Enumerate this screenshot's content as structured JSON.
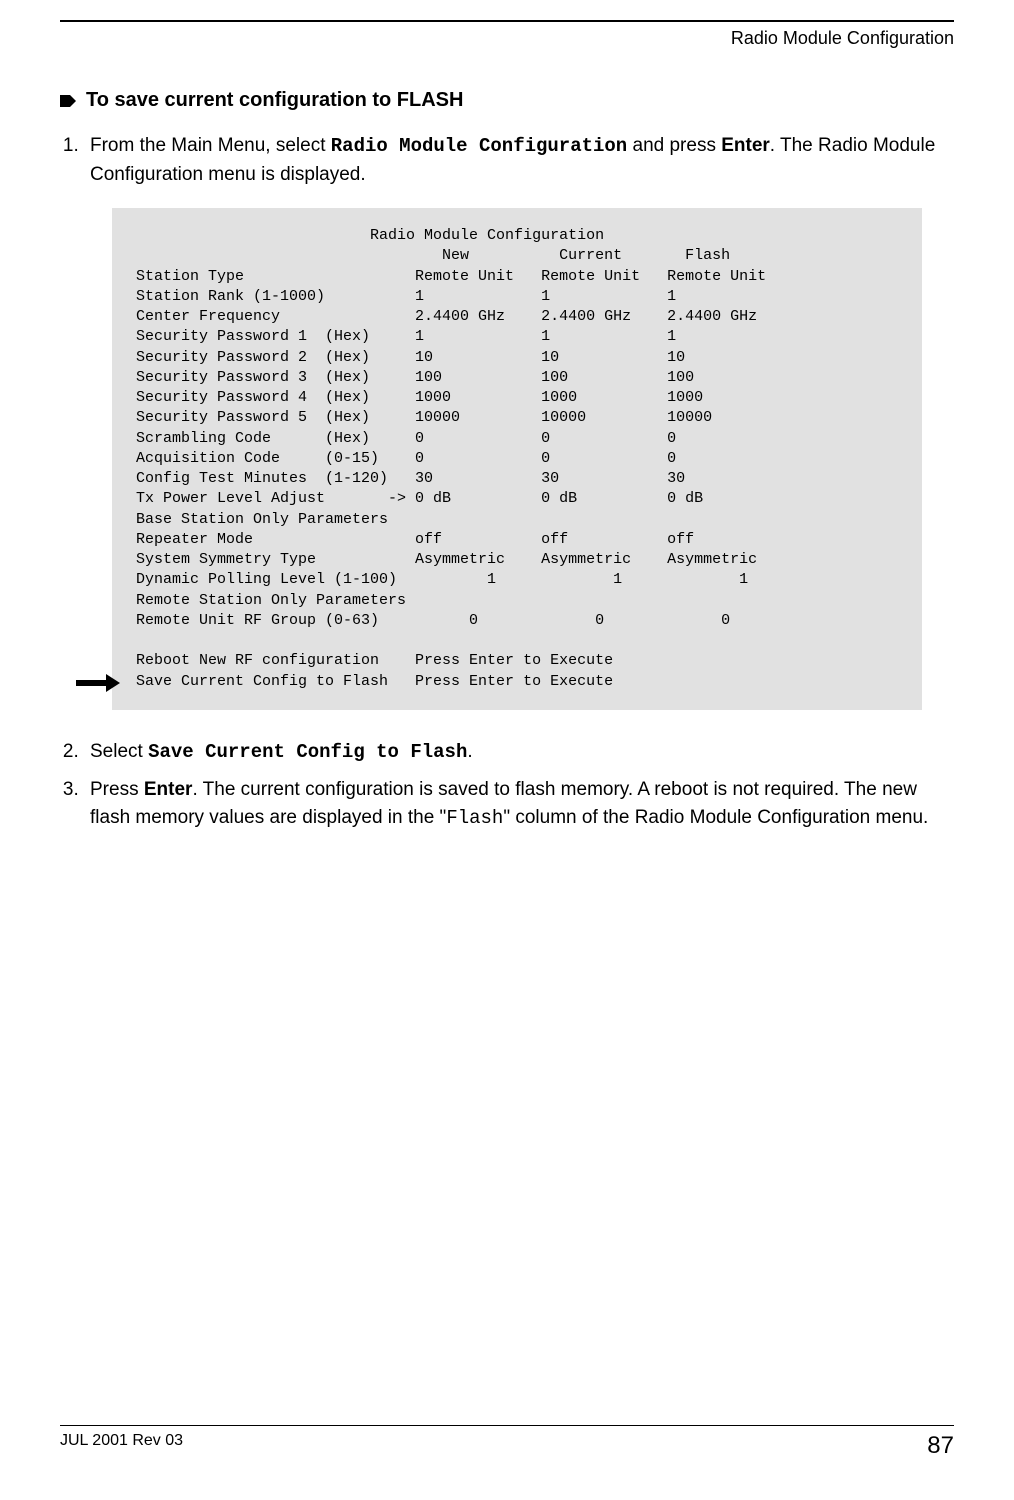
{
  "header": {
    "section": "Radio Module Configuration"
  },
  "section_title": "To save current configuration to FLASH",
  "steps": {
    "s1": {
      "pre": "From the Main Menu, select ",
      "menu": "Radio Module Configuration",
      "mid": " and press ",
      "key": "Enter",
      "post": ". The Radio Module Configuration menu is displayed."
    },
    "s2": {
      "pre": "Select ",
      "menu": "Save Current Config to Flash",
      "post": "."
    },
    "s3": {
      "pre": "Press ",
      "key": "Enter",
      "mid": ". The current configuration is saved to flash memory. A reboot is not required. The new flash memory values are displayed in the \"",
      "col": "Flash",
      "post": "\" column of the Radio Module Configuration menu."
    }
  },
  "terminal": {
    "title": "Radio Module Configuration",
    "col1": "New",
    "col2": "Current",
    "col3": "Flash",
    "rows": [
      {
        "label": "Station Type",
        "hint": "",
        "new": "Remote Unit",
        "cur": "Remote Unit",
        "fl": "Remote Unit"
      },
      {
        "label": "Station Rank (1-1000)",
        "hint": "",
        "new": "1",
        "cur": "1",
        "fl": "1"
      },
      {
        "label": "Center Frequency",
        "hint": "",
        "new": "2.4400 GHz",
        "cur": "2.4400 GHz",
        "fl": "2.4400 GHz"
      },
      {
        "label": "Security Password 1",
        "hint": "(Hex)",
        "new": "1",
        "cur": "1",
        "fl": "1"
      },
      {
        "label": "Security Password 2",
        "hint": "(Hex)",
        "new": "10",
        "cur": "10",
        "fl": "10"
      },
      {
        "label": "Security Password 3",
        "hint": "(Hex)",
        "new": "100",
        "cur": "100",
        "fl": "100"
      },
      {
        "label": "Security Password 4",
        "hint": "(Hex)",
        "new": "1000",
        "cur": "1000",
        "fl": "1000"
      },
      {
        "label": "Security Password 5",
        "hint": "(Hex)",
        "new": "10000",
        "cur": "10000",
        "fl": "10000"
      },
      {
        "label": "Scrambling Code",
        "hint": "(Hex)",
        "new": "0",
        "cur": "0",
        "fl": "0"
      },
      {
        "label": "Acquisition Code",
        "hint": "(0-15)",
        "new": "0",
        "cur": "0",
        "fl": "0"
      },
      {
        "label": "Config Test Minutes",
        "hint": "(1-120)",
        "new": "30",
        "cur": "30",
        "fl": "30"
      },
      {
        "label": "Tx Power Level Adjust",
        "hint": "",
        "new": "0 dB",
        "cur": "0 dB",
        "fl": "0 dB",
        "marker": "->"
      }
    ],
    "base_header": "Base Station Only Parameters",
    "base_rows": [
      {
        "label": "Repeater Mode",
        "hint": "",
        "new": "off",
        "cur": "off",
        "fl": "off"
      },
      {
        "label": "System Symmetry Type",
        "hint": "",
        "new": "Asymmetric",
        "cur": "Asymmetric",
        "fl": "Asymmetric"
      },
      {
        "label": "Dynamic Polling Level (1-100)",
        "hint": "",
        "new": "1",
        "cur": "1",
        "fl": "1"
      }
    ],
    "remote_header": "Remote Station Only Parameters",
    "remote_rows": [
      {
        "label": "Remote Unit RF Group (0-63)",
        "hint": "",
        "new": "0",
        "cur": "0",
        "fl": "0"
      }
    ],
    "actions": [
      {
        "label": "Reboot New RF configuration",
        "msg": "Press Enter to Execute"
      },
      {
        "label": "Save Current Config to Flash",
        "msg": "Press Enter to Execute"
      }
    ]
  },
  "footer": {
    "left": "JUL 2001 Rev 03",
    "page": "87"
  }
}
